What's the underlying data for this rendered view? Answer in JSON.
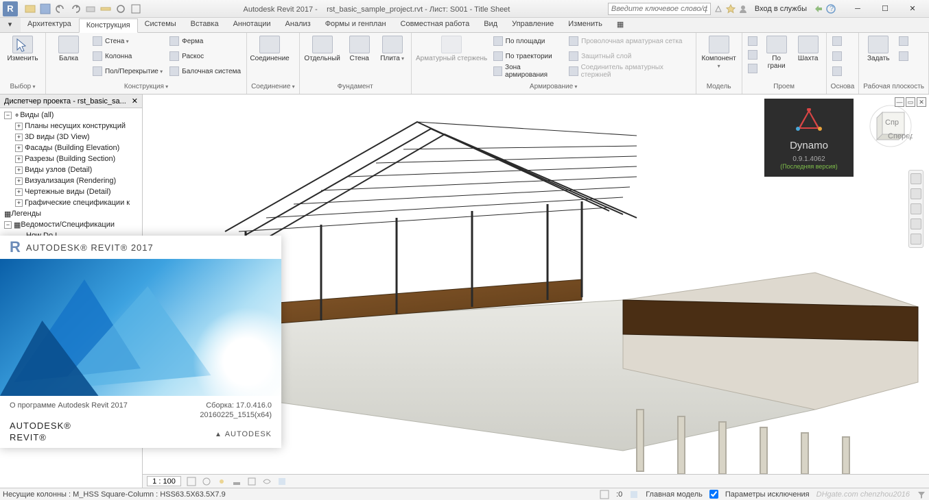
{
  "titlebar": {
    "app": "Autodesk Revit 2017 -",
    "doc": "rst_basic_sample_project.rvt - Лист: S001 - Title Sheet",
    "search_placeholder": "Введите ключевое слово/фразу",
    "signin": "Вход в службы",
    "app_icon_letter": "R"
  },
  "tabs": [
    "Архитектура",
    "Конструкция",
    "Системы",
    "Вставка",
    "Аннотации",
    "Анализ",
    "Формы и генплан",
    "Совместная работа",
    "Вид",
    "Управление",
    "Изменить"
  ],
  "active_tab_index": 1,
  "ribbon": {
    "p_select": {
      "title": "Выбор",
      "modify": "Изменить"
    },
    "p_construct": {
      "title": "Конструкция",
      "big": "Балка",
      "items_a": [
        "Стена",
        "Колонна",
        "Пол/Перекрытие"
      ],
      "items_b": [
        "Ферма",
        "Раскос",
        "Балочная система"
      ]
    },
    "p_join": {
      "title": "Соединение",
      "big": "Соединение"
    },
    "p_found": {
      "title": "Фундамент",
      "big1": "Отдельный",
      "big2": "Стена",
      "big3": "Плита"
    },
    "p_rebar": {
      "title": "Армирование",
      "big_disabled": "Арматурный стержень",
      "items_a": [
        "По площади",
        "По траектории",
        "Зона  армирования"
      ],
      "items_b_disabled": [
        "Проволочная  арматурная сетка",
        "Защитный слой",
        "Соединитель арматурных стержней"
      ]
    },
    "p_model": {
      "title": "Модель",
      "big": "Компонент"
    },
    "p_open": {
      "title": "Проем",
      "big": "По грани",
      "big2": "Шахта"
    },
    "p_base": {
      "title": "Основа"
    },
    "p_workplane": {
      "title": "Рабочая плоскость",
      "big": "Задать"
    }
  },
  "browser": {
    "title": "Диспетчер проекта - rst_basic_sa...",
    "root": "Виды (all)",
    "items": [
      "Планы несущих конструкций",
      "3D виды (3D View)",
      "Фасады (Building Elevation)",
      "Разрезы (Building Section)",
      "Виды узлов (Detail)",
      "Визуализация (Rendering)",
      "Чертежные виды (Detail)",
      "Графические спецификации к"
    ],
    "group2": "Легенды",
    "group3": "Ведомости/Спецификации",
    "g3_items": [
      "How Do I"
    ]
  },
  "splash": {
    "brand_top": "AUTODESK® REVIT® 2017",
    "about": "О программе Autodesk Revit 2017",
    "build_label": "Сборка:",
    "build_ver": "17.0.416.0",
    "build_date": "20160225_1515(x64)",
    "brand1": "AUTODESK®",
    "brand2": "REVIT®",
    "company": "AUTODESK"
  },
  "dynamo": {
    "name": "Dynamo",
    "version": "0.9.1.4062",
    "note": "(Последняя версия)"
  },
  "viewcube": {
    "face1": "Спр",
    "face2": "Спереди"
  },
  "viewbar": {
    "scale": "1 : 100",
    "tick_marks": "⬚"
  },
  "statusbar": {
    "hint": "Несущие колонны : M_HSS Square-Column : HSS63.5X63.5X7.9",
    "model": "Главная модель",
    "filter": "Параметры исключения",
    "zero": ":0",
    "watermark": "DHgate.com  chenzhou2016"
  }
}
